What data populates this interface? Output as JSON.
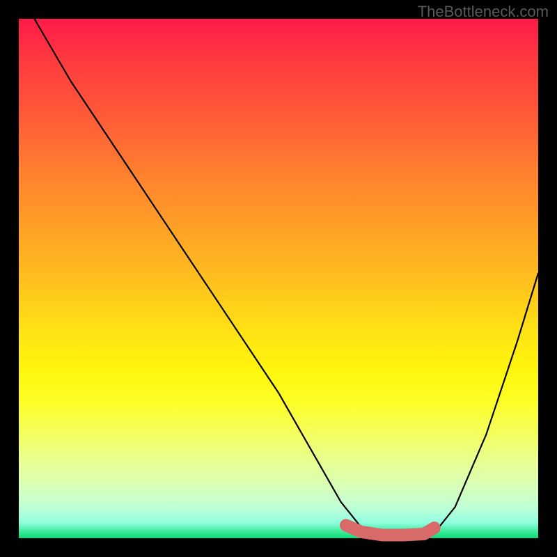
{
  "watermark": "TheBottleneck.com",
  "chart_data": {
    "type": "line",
    "title": "",
    "xlabel": "",
    "ylabel": "",
    "xlim": [
      0,
      100
    ],
    "ylim": [
      0,
      100
    ],
    "series": [
      {
        "name": "bottleneck-curve",
        "x": [
          3,
          10,
          20,
          30,
          40,
          50,
          58,
          62,
          66,
          70,
          74,
          78,
          80,
          84,
          90,
          96,
          100
        ],
        "values": [
          100,
          88,
          73,
          58,
          43,
          28,
          14,
          7,
          2,
          0,
          0,
          0,
          1,
          6,
          20,
          38,
          51
        ]
      },
      {
        "name": "highlight-band",
        "x": [
          63,
          66,
          70,
          74,
          78,
          80
        ],
        "values": [
          2.5,
          1.2,
          0.6,
          0.6,
          0.8,
          2.0
        ]
      }
    ],
    "gradient_stops": [
      {
        "pct": 0,
        "color": "#ff1a4a"
      },
      {
        "pct": 18,
        "color": "#ff5838"
      },
      {
        "pct": 38,
        "color": "#ff9a28"
      },
      {
        "pct": 56,
        "color": "#ffd418"
      },
      {
        "pct": 74,
        "color": "#fdff28"
      },
      {
        "pct": 90,
        "color": "#d8ffb8"
      },
      {
        "pct": 100,
        "color": "#10d87a"
      }
    ],
    "highlight_color": "#d96a6a"
  }
}
